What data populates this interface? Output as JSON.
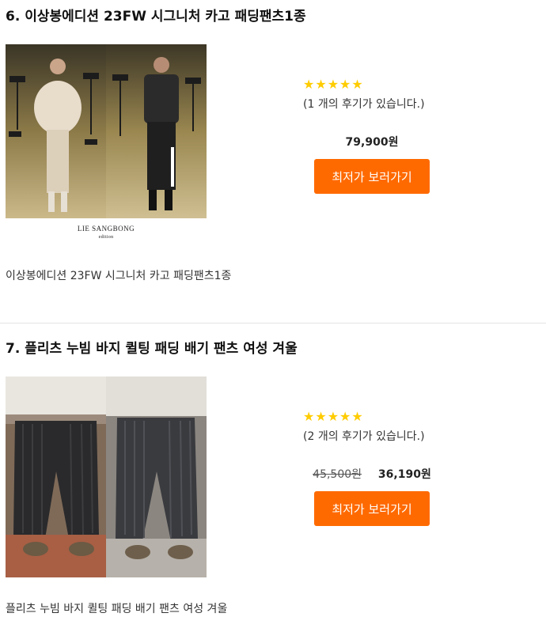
{
  "products": [
    {
      "title": "6. 이상봉에디션 23FW 시그니처 카고 패딩팬츠1종",
      "brand_logo_text": "LIE SANGBONG",
      "brand_logo_sub": "edition",
      "rating_stars": "★★★★★",
      "review_text": "(1 개의 후기가 있습니다.)",
      "price": "79,900원",
      "cta_label": "최저가 보러가기",
      "description": "이상봉에디션 23FW 시그니처 카고 패딩팬츠1종"
    },
    {
      "title": "7. 플리츠 누빔 바지 퀼팅 패딩 배기 팬츠 여성 겨울",
      "rating_stars": "★★★★★",
      "review_text": "(2 개의 후기가 있습니다.)",
      "original_price": "45,500원",
      "price": "36,190원",
      "cta_label": "최저가 보러가기",
      "description": "플리츠 누빔 바지 퀼팅 패딩 배기 팬츠 여성 겨울"
    }
  ],
  "colors": {
    "cta_background": "#ff6a00",
    "star": "#ffcc00",
    "divider": "#e4e4e4"
  }
}
